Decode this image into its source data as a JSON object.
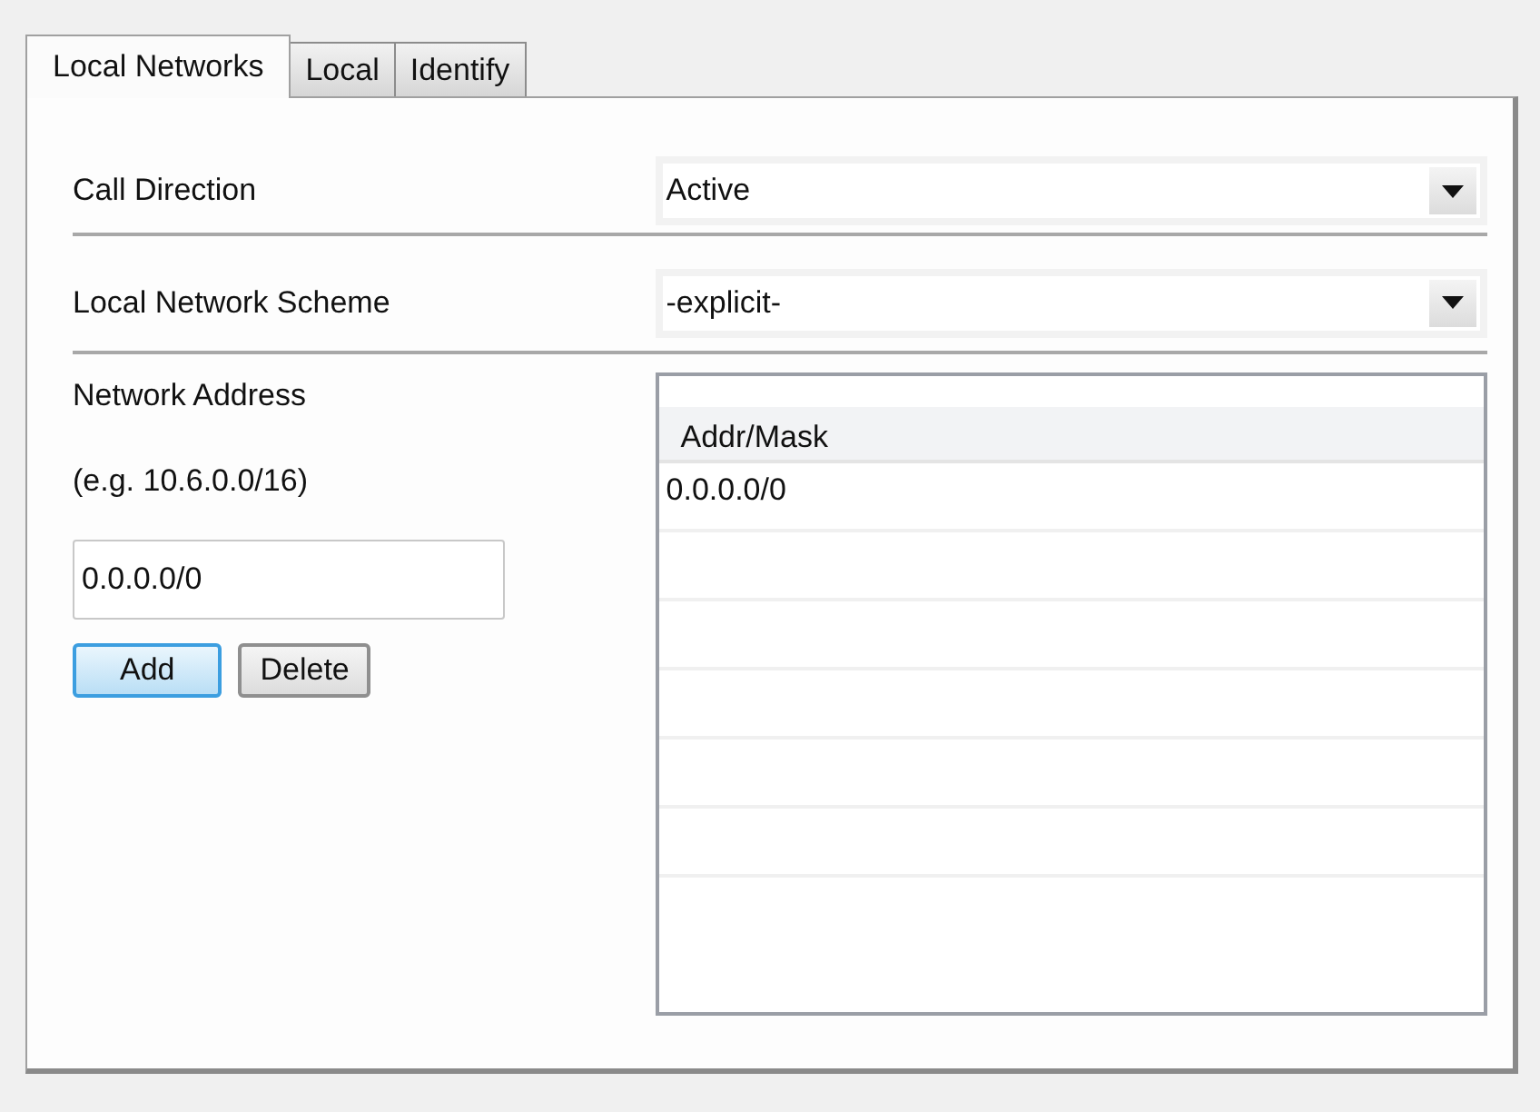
{
  "tabs": [
    {
      "label": "Local Networks",
      "selected": true
    },
    {
      "label": "Local",
      "selected": false
    },
    {
      "label": "Identify",
      "selected": false
    }
  ],
  "fields": [
    {
      "label": "Call Direction",
      "value": "Active"
    },
    {
      "label": "Local Network Scheme",
      "value": "-explicit-"
    }
  ],
  "address": {
    "label": "Network Address",
    "hint": "(e.g. 10.6.0.0/16)",
    "value": "0.0.0.0/0"
  },
  "buttons": [
    {
      "label": "Add",
      "focused": true
    },
    {
      "label": "Delete",
      "focused": false
    }
  ],
  "table": {
    "columns": [
      "Addr/Mask"
    ],
    "rows": [
      [
        "0.0.0.0/0"
      ]
    ]
  }
}
